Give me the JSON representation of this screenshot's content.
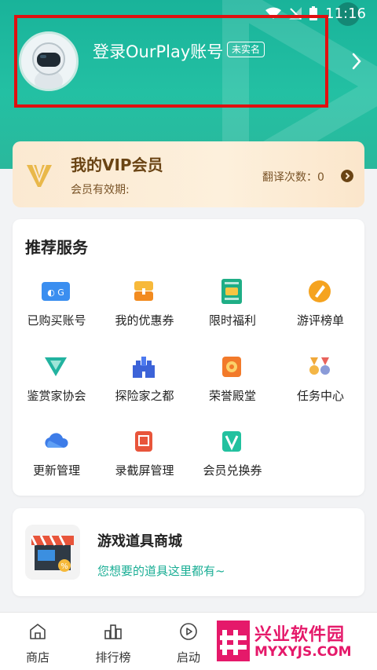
{
  "status_bar": {
    "time": "11:16"
  },
  "profile": {
    "login_text": "登录OurPlay账号",
    "realname_badge": "未实名"
  },
  "vip": {
    "title": "我的VIP会员",
    "subtitle": "会员有效期:",
    "count_text": "翻译次数：0"
  },
  "services": {
    "title": "推荐服务",
    "items": [
      {
        "label": "已购买账号",
        "icon": "purchased-account-icon"
      },
      {
        "label": "我的优惠券",
        "icon": "coupon-icon"
      },
      {
        "label": "限时福利",
        "icon": "limited-benefit-icon"
      },
      {
        "label": "游评榜单",
        "icon": "game-review-rank-icon"
      },
      {
        "label": "鉴赏家协会",
        "icon": "connoisseur-icon"
      },
      {
        "label": "探险家之都",
        "icon": "explorer-castle-icon"
      },
      {
        "label": "荣誉殿堂",
        "icon": "honor-hall-icon"
      },
      {
        "label": "任务中心",
        "icon": "task-center-icon"
      },
      {
        "label": "更新管理",
        "icon": "update-cloud-icon"
      },
      {
        "label": "录截屏管理",
        "icon": "screen-record-icon"
      },
      {
        "label": "会员兑换券",
        "icon": "vip-voucher-icon"
      }
    ]
  },
  "shop": {
    "title": "游戏道具商城",
    "subtitle": "您想要的道具这里都有~"
  },
  "tabs": [
    {
      "label": "商店",
      "icon": "store-icon"
    },
    {
      "label": "排行榜",
      "icon": "ranking-icon"
    },
    {
      "label": "启动",
      "icon": "launch-icon"
    }
  ],
  "watermark": {
    "title": "兴业软件园",
    "url": "MYXYJS.COM"
  },
  "colors": {
    "header_green": "#1fb99d",
    "highlight_box": "#e01010",
    "vip_brown": "#6a4414",
    "shop_green": "#1aae95",
    "watermark_pink": "#e5196a"
  }
}
